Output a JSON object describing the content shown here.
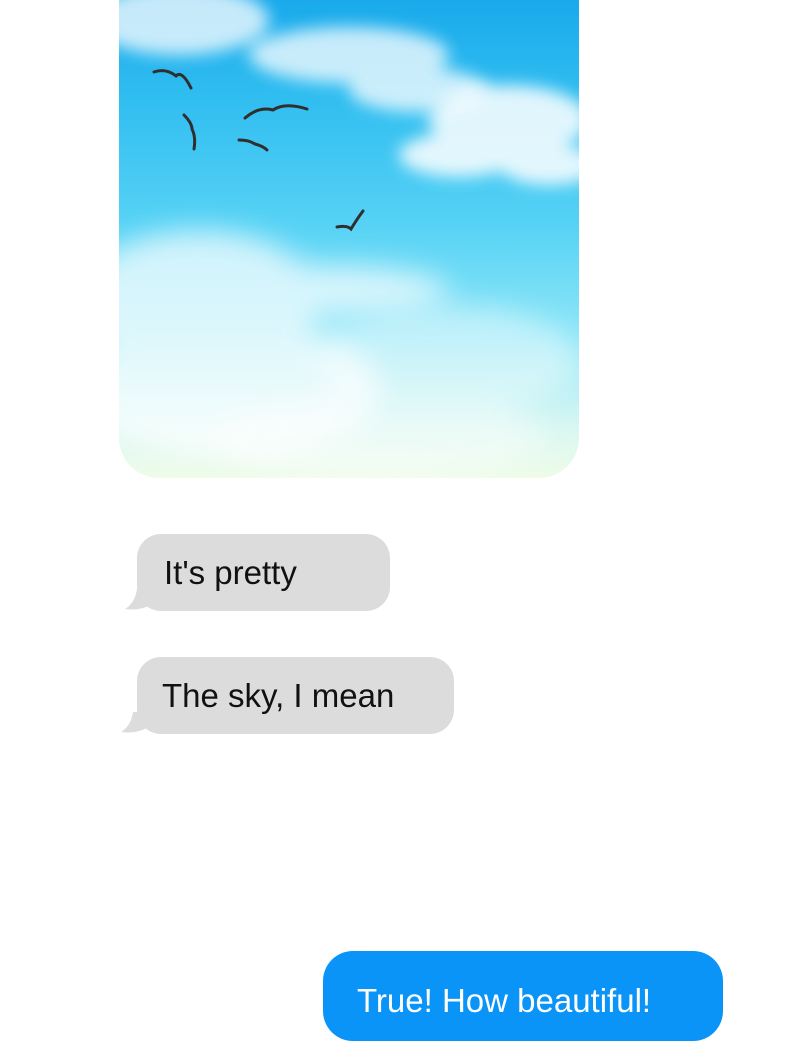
{
  "conversation": {
    "photo": {
      "subject": "blue sky with clouds and flying birds",
      "colors": {
        "sky_top": "#12a4ea",
        "sky_bottom": "#eefce8"
      }
    },
    "messages": [
      {
        "direction": "incoming",
        "text": "It's pretty"
      },
      {
        "direction": "incoming",
        "text": "The sky, I mean"
      },
      {
        "direction": "outgoing",
        "text": "True! How beautiful!"
      }
    ]
  },
  "theme": {
    "incoming_bubble": "#dcdcdc",
    "outgoing_bubble": "#0b94f8",
    "background": "#ffffff"
  }
}
